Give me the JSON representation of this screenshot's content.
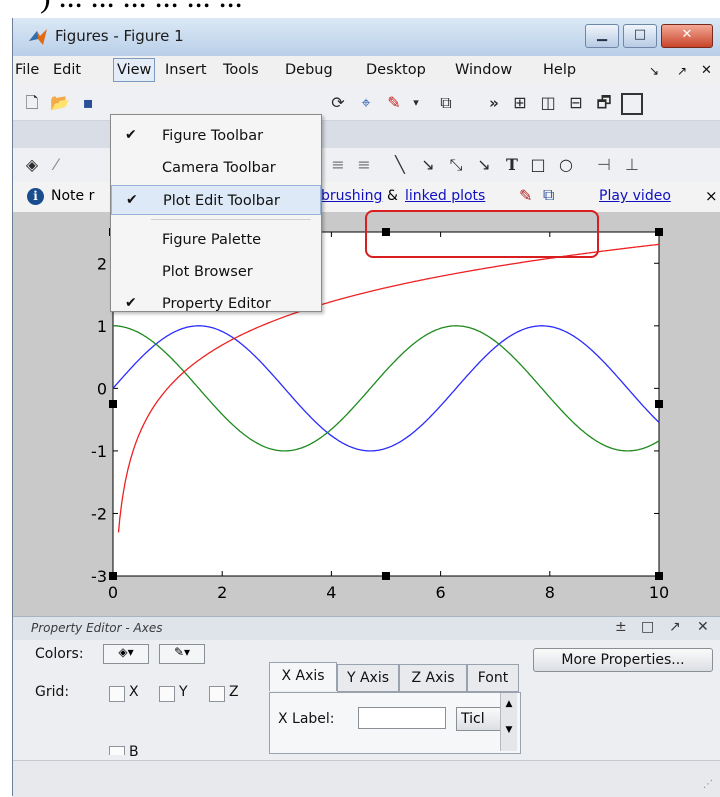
{
  "window": {
    "title": "Figures - Figure 1"
  },
  "menubar": {
    "items": [
      "File",
      "Edit",
      "View",
      "Insert",
      "Tools",
      "Debug",
      "Desktop",
      "Window",
      "Help"
    ],
    "active": "View"
  },
  "view_menu": {
    "items": [
      {
        "label": "Figure Toolbar",
        "checked": true
      },
      {
        "label": "Camera Toolbar",
        "checked": false
      },
      {
        "label": "Plot Edit Toolbar",
        "checked": true,
        "highlighted": true
      },
      {
        "label": "Figure Palette",
        "checked": false
      },
      {
        "label": "Plot Browser",
        "checked": false
      },
      {
        "label": "Property Editor",
        "checked": true
      }
    ]
  },
  "infobar": {
    "prefix": "Note r",
    "link1": "brushing",
    "amp": "&",
    "link2": "linked plots",
    "play": "Play video",
    "close": "×"
  },
  "chart_data": {
    "type": "line",
    "xlim": [
      0,
      10
    ],
    "ylim": [
      -3,
      2.5
    ],
    "x_ticks": [
      "0",
      "2",
      "4",
      "6",
      "8",
      "10"
    ],
    "y_ticks": [
      "-3",
      "-2",
      "-1",
      "0",
      "1",
      "2"
    ],
    "series": [
      {
        "color": "#2b2bff",
        "function": "sin(x)",
        "x": [
          0,
          1,
          1.57,
          2,
          3,
          4,
          4.71,
          5,
          6,
          7,
          7.85,
          9,
          10
        ],
        "values": [
          0,
          0.84,
          1,
          0.91,
          0.14,
          -0.76,
          -1,
          -0.96,
          -0.28,
          0.66,
          1,
          0.41,
          -0.54
        ]
      },
      {
        "color": "#1e8a1e",
        "function": "cos(x)",
        "x": [
          0,
          1,
          2,
          3,
          3.14,
          4,
          5,
          6,
          6.28,
          7,
          8,
          9,
          9.42,
          10
        ],
        "values": [
          1,
          0.54,
          -0.42,
          -0.99,
          -1,
          -0.65,
          0.28,
          0.96,
          1,
          0.75,
          -0.15,
          -0.91,
          -1,
          -0.84
        ]
      },
      {
        "color": "#ee2222",
        "function": "log(x)",
        "x": [
          0.1,
          0.5,
          1,
          2,
          3,
          4,
          5,
          6,
          7,
          8,
          9,
          10
        ],
        "values": [
          -2.3,
          -0.69,
          0,
          0.69,
          1.1,
          1.39,
          1.61,
          1.79,
          1.95,
          2.08,
          2.2,
          2.3
        ]
      }
    ]
  },
  "property_editor": {
    "title": "Property Editor - Axes",
    "colors_label": "Colors:",
    "grid_label": "Grid:",
    "grid_x": "X",
    "grid_y": "Y",
    "grid_z": "Z",
    "tabs": [
      "X Axis",
      "Y Axis",
      "Z Axis",
      "Font"
    ],
    "xlabel_label": "X Label:",
    "xlabel_value": "",
    "ticks_btn": "Ticl",
    "more_properties": "More Properties...",
    "box_label": "B",
    "header_buttons": [
      "±",
      "□",
      "↗",
      "✕"
    ]
  },
  "colors": {
    "annotation_border": "#d81e1e",
    "link": "#1010c0"
  }
}
